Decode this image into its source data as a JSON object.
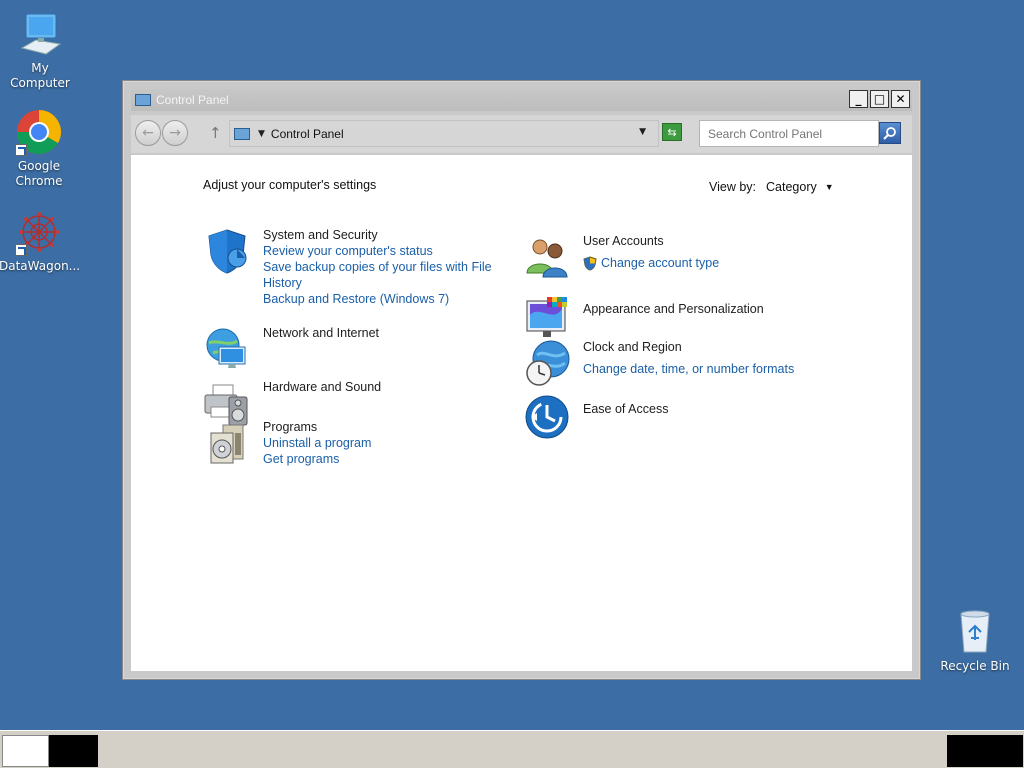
{
  "desktop": {
    "icons": [
      {
        "label": "My Computer"
      },
      {
        "label": "Google Chrome"
      },
      {
        "label": "DataWagon..."
      },
      {
        "label": "Recycle Bin"
      }
    ]
  },
  "window": {
    "title": "Control Panel",
    "buttons": {
      "minimize": "_",
      "maximize": "□",
      "close": "✕"
    },
    "address": {
      "crumb": "Control Panel"
    },
    "search": {
      "placeholder": "Search Control Panel"
    }
  },
  "content": {
    "heading": "Adjust your computer's settings",
    "view_by": {
      "label": "View by:",
      "value": "Category"
    },
    "categories": [
      {
        "name": "System and Security",
        "links": [
          "Review your computer's status",
          "Save backup copies of your files with File History",
          "Backup and Restore (Windows 7)"
        ]
      },
      {
        "name": "Network and Internet",
        "links": []
      },
      {
        "name": "Hardware and Sound",
        "links": []
      },
      {
        "name": "Programs",
        "links": [
          "Uninstall a program",
          "Get programs"
        ]
      },
      {
        "name": "User Accounts",
        "links": [
          "Change account type"
        ]
      },
      {
        "name": "Appearance and Personalization",
        "links": []
      },
      {
        "name": "Clock and Region",
        "links": [
          "Change date, time, or number formats"
        ]
      },
      {
        "name": "Ease of Access",
        "links": []
      }
    ]
  },
  "colors": {
    "desktop": "#3c6ea5",
    "link": "#1a5fa8",
    "taskbar": "#d4d0c8"
  }
}
